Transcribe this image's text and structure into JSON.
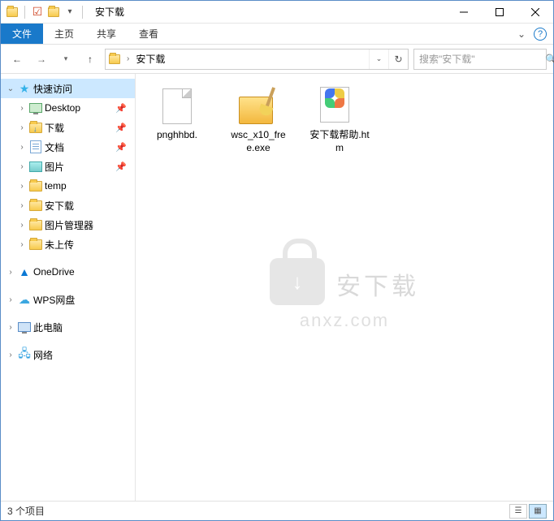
{
  "window": {
    "title": "安下载"
  },
  "ribbon": {
    "file": "文件",
    "tabs": [
      "主页",
      "共享",
      "查看"
    ]
  },
  "address": {
    "segments": [
      "安下载"
    ]
  },
  "search": {
    "placeholder": "搜索\"安下载\""
  },
  "nav": {
    "quick": {
      "label": "快速访问",
      "expanded": true
    },
    "quick_items": [
      {
        "label": "Desktop",
        "icon": "desktop",
        "pinned": true
      },
      {
        "label": "下载",
        "icon": "download",
        "pinned": true
      },
      {
        "label": "文档",
        "icon": "doc",
        "pinned": true
      },
      {
        "label": "图片",
        "icon": "pic",
        "pinned": true
      },
      {
        "label": "temp",
        "icon": "folder",
        "pinned": false
      },
      {
        "label": "安下载",
        "icon": "folder",
        "pinned": false
      },
      {
        "label": "图片管理器",
        "icon": "folder",
        "pinned": false
      },
      {
        "label": "未上传",
        "icon": "folder",
        "pinned": false
      }
    ],
    "onedrive": "OneDrive",
    "wps": "WPS网盘",
    "pc": "此电脑",
    "network": "网络"
  },
  "files": [
    {
      "name": "pnghhbd.",
      "type": "blank"
    },
    {
      "name": "wsc_x10_free.exe",
      "type": "exe"
    },
    {
      "name": "安下载帮助.htm",
      "type": "htm"
    }
  ],
  "watermark": {
    "brand": "安下载",
    "domain": "anxz.com"
  },
  "status": {
    "count": "3 个项目"
  }
}
